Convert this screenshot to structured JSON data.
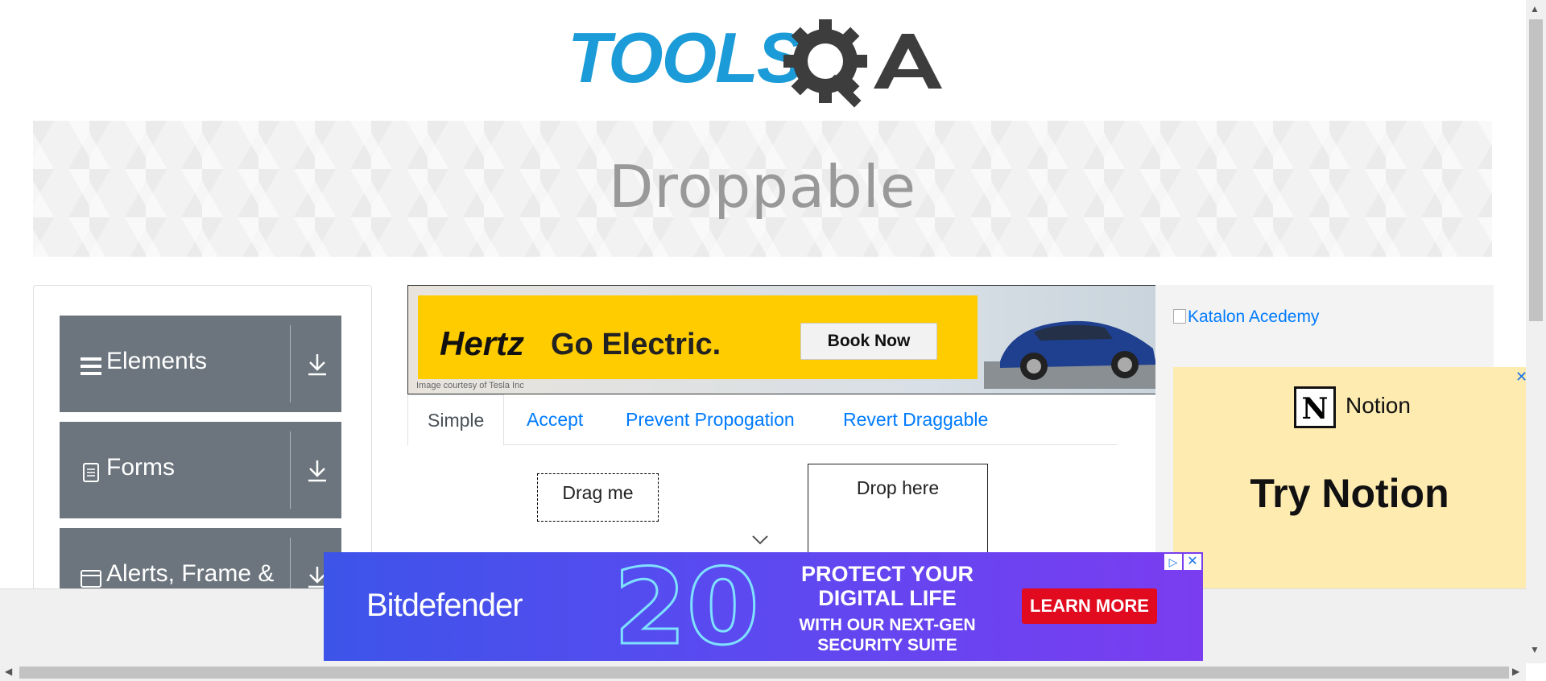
{
  "brand": {
    "logo_text": "TOOLSQA",
    "primary_color": "#1b9bd7",
    "dark_color": "#3d3d3d"
  },
  "page_title": "Droppable",
  "sidebar": {
    "groups": [
      {
        "label": "Elements",
        "icon": "hamburger-icon"
      },
      {
        "label": "Forms",
        "icon": "document-icon"
      },
      {
        "label": "Alerts, Frame &",
        "icon": "window-icon"
      }
    ]
  },
  "ad_hertz": {
    "brand": "Hertz",
    "tagline": "Go Electric.",
    "button": "Book Now",
    "credit": "Image courtesy of Tesla Inc"
  },
  "tabs": [
    {
      "label": "Simple",
      "active": true
    },
    {
      "label": "Accept",
      "active": false
    },
    {
      "label": "Prevent Propogation",
      "active": false
    },
    {
      "label": "Revert Draggable",
      "active": false
    }
  ],
  "draggable": {
    "label": "Drag me"
  },
  "droppable": {
    "label": "Drop here"
  },
  "right_ad": {
    "katalon_alt": "Katalon Acedemy",
    "notion_name": "Notion",
    "notion_logo": "N",
    "notion_cta": "Try Notion",
    "close": "✕"
  },
  "ad_bitdefender": {
    "brand": "Bitdefender",
    "number": "20",
    "headline_1": "PROTECT YOUR",
    "headline_2": "DIGITAL LIFE",
    "sub_1": "WITH OUR NEXT-GEN",
    "sub_2": "SECURITY SUITE",
    "button": "LEARN MORE",
    "adchoice": "▷",
    "close": "✕"
  },
  "scrollbars": {
    "up": "▲",
    "down": "▼",
    "left": "◀",
    "right": "▶"
  }
}
